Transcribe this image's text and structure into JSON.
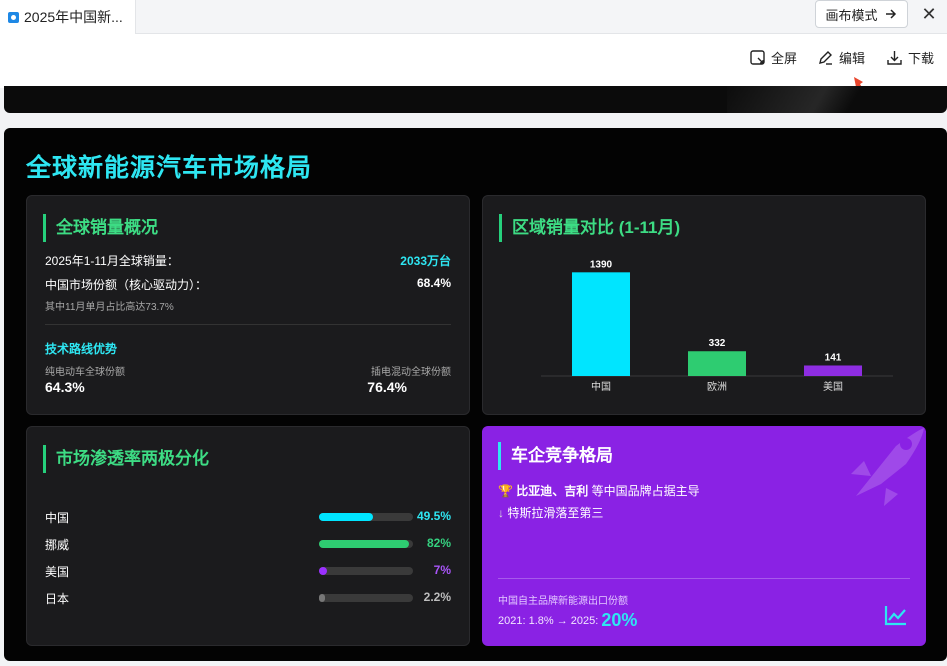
{
  "browser": {
    "tab_title": "2025年中国新...",
    "canvas_mode_label": "画布模式",
    "close_glyph": "✕"
  },
  "toolbar": {
    "fullscreen_label": "全屏",
    "edit_label": "编辑",
    "download_label": "下载"
  },
  "page": {
    "title": "全球新能源汽车市场格局"
  },
  "global_sales": {
    "title": "全球销量概况",
    "total_label": "2025年1-11月全球销量：",
    "total_value": "2033万台",
    "china_share_label": "中国市场份额（核心驱动力）：",
    "china_share_value": "68.4%",
    "note": "其中11月单月占比高达73.7%",
    "tech_title": "技术路线优势",
    "bev_label": "纯电动车全球份额",
    "bev_value": "64.3%",
    "phev_label": "插电混动全球份额",
    "phev_value": "76.4%"
  },
  "regional": {
    "title": "区域销量对比 (1-11月)"
  },
  "chart_data": {
    "type": "bar",
    "categories": [
      "中国",
      "欧洲",
      "美国"
    ],
    "values": [
      1390,
      332,
      141
    ],
    "value_labels": [
      "1390",
      "332",
      "141"
    ],
    "colors": [
      "#00e5ff",
      "#2ecc71",
      "#8e2de2"
    ],
    "title": "区域销量对比 (1-11月)",
    "xlabel": "",
    "ylabel": "",
    "ylim": [
      0,
      1450
    ],
    "grid": false
  },
  "penetration": {
    "title": "市场渗透率两极分化",
    "rows": [
      {
        "name": "中国",
        "value": 49.5,
        "label": "49.5%",
        "color": "#00e5ff"
      },
      {
        "name": "挪威",
        "value": 82,
        "label": "82%",
        "color": "#2ecc71"
      },
      {
        "name": "美国",
        "value": 7,
        "label": "7%",
        "color": "#9b30ff"
      },
      {
        "name": "日本",
        "value": 2.2,
        "label": "2.2%",
        "color": "#777777"
      }
    ]
  },
  "competition": {
    "title": "车企竞争格局",
    "line1_brands": "比亚迪、吉利",
    "line1_rest": " 等中国品牌占据主导",
    "line2": "特斯拉滑落至第三",
    "export_label": "中国自主品牌新能源出口份额",
    "export_trend": "2021: 1.8% → 2025:",
    "export_value": "20%",
    "trophy_glyph": "🏆",
    "down_glyph": "↓"
  },
  "colors": {
    "accent_cyan": "#2ee6f2",
    "accent_green": "#35d07f",
    "accent_purple": "#8a22e4"
  },
  "icons": [
    "fullscreen-icon",
    "edit-icon",
    "download-icon",
    "trophy-icon",
    "arrow-down-icon",
    "trend-chart-icon",
    "rocket-icon"
  ]
}
